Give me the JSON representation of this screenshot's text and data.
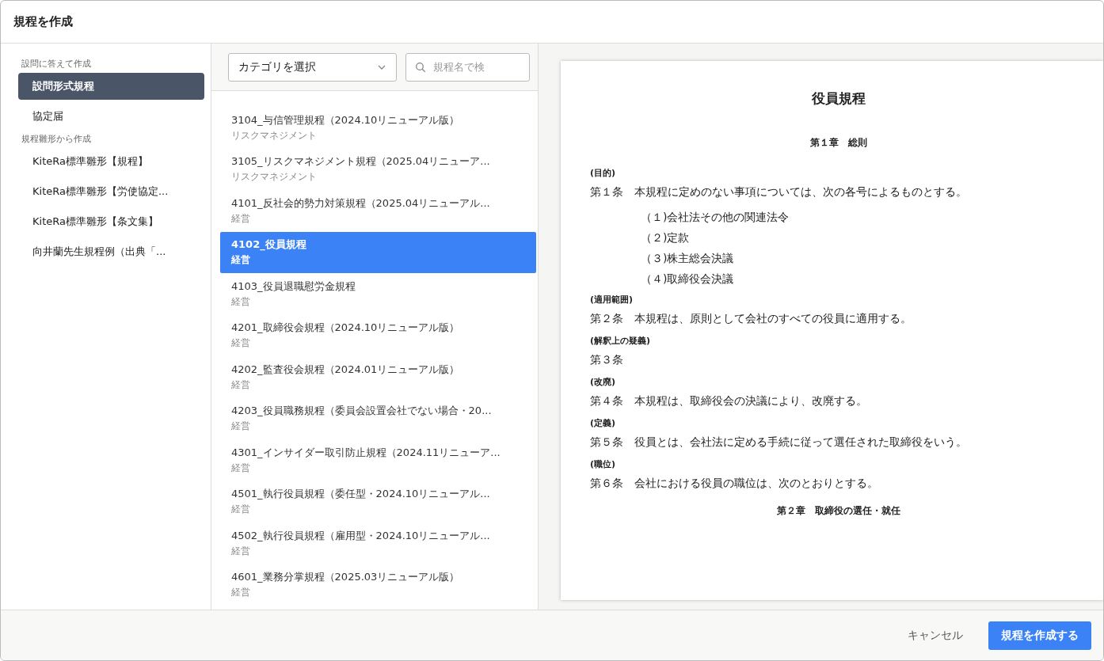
{
  "window": {
    "title": "規程を作成"
  },
  "sidebar": {
    "groups": [
      {
        "label": "設問に答えて作成",
        "items": [
          {
            "label": "設問形式規程",
            "selected": true
          },
          {
            "label": "協定届",
            "selected": false
          }
        ]
      },
      {
        "label": "規程雛形から作成",
        "items": [
          {
            "label": "KiteRa標準雛形【規程】",
            "selected": false
          },
          {
            "label": "KiteRa標準雛形【労使協定...",
            "selected": false
          },
          {
            "label": "KiteRa標準雛形【条文集】",
            "selected": false
          },
          {
            "label": "向井蘭先生規程例（出典「...",
            "selected": false
          }
        ]
      }
    ]
  },
  "filters": {
    "category": {
      "value": "カテゴリを選択"
    },
    "search": {
      "placeholder": "規程名で検"
    }
  },
  "templates": [
    {
      "name": "3104_与信管理規程（2024.10リニューアル版）",
      "category": "リスクマネジメント",
      "selected": false
    },
    {
      "name": "3105_リスクマネジメント規程（2025.04リニューア...",
      "category": "リスクマネジメント",
      "selected": false
    },
    {
      "name": "4101_反社会的勢力対策規程（2025.04リニューアル...",
      "category": "経営",
      "selected": false
    },
    {
      "name": "4102_役員規程",
      "category": "経営",
      "selected": true
    },
    {
      "name": "4103_役員退職慰労金規程",
      "category": "経営",
      "selected": false
    },
    {
      "name": "4201_取締役会規程（2024.10リニューアル版）",
      "category": "経営",
      "selected": false
    },
    {
      "name": "4202_監査役会規程（2024.01リニューアル版）",
      "category": "経営",
      "selected": false
    },
    {
      "name": "4203_役員職務規程（委員会設置会社でない場合・20...",
      "category": "経営",
      "selected": false
    },
    {
      "name": "4301_インサイダー取引防止規程（2024.11リニューア...",
      "category": "経営",
      "selected": false
    },
    {
      "name": "4501_執行役員規程（委任型・2024.10リニューアル...",
      "category": "経営",
      "selected": false
    },
    {
      "name": "4502_執行役員規程（雇用型・2024.10リニューアル...",
      "category": "経営",
      "selected": false
    },
    {
      "name": "4601_業務分掌規程（2025.03リニューアル版）",
      "category": "経営",
      "selected": false
    }
  ],
  "preview": {
    "title": "役員規程",
    "blocks": [
      {
        "kind": "chapter",
        "text": "第１章　総則"
      },
      {
        "kind": "heading",
        "text": "(目的)"
      },
      {
        "kind": "article",
        "text": "第１条　本規程に定めのない事項については、次の各号によるものとする。"
      },
      {
        "kind": "clause",
        "text": "（１)会社法その他の関連法令"
      },
      {
        "kind": "clause",
        "text": "（２)定款"
      },
      {
        "kind": "clause",
        "text": "（３)株主総会決議"
      },
      {
        "kind": "clause",
        "text": "（４)取締役会決議"
      },
      {
        "kind": "heading",
        "text": "(適用範囲)"
      },
      {
        "kind": "article",
        "text": "第２条　本規程は、原則として会社のすべての役員に適用する。"
      },
      {
        "kind": "heading",
        "text": "(解釈上の疑義)"
      },
      {
        "kind": "article",
        "text": "第３条"
      },
      {
        "kind": "heading",
        "text": "(改廃)"
      },
      {
        "kind": "article",
        "text": "第４条　本規程は、取締役会の決議により、改廃する。"
      },
      {
        "kind": "heading",
        "text": "(定義)"
      },
      {
        "kind": "article",
        "text": "第５条　役員とは、会社法に定める手続に従って選任された取締役をいう。"
      },
      {
        "kind": "heading",
        "text": "(職位)"
      },
      {
        "kind": "article",
        "text": "第６条　会社における役員の職位は、次のとおりとする。"
      },
      {
        "kind": "chapter",
        "text": "第２章　取締役の選任・就任"
      }
    ]
  },
  "footer": {
    "buttons": [
      {
        "label": "キャンセル",
        "kind": "secondary"
      },
      {
        "label": "規程を作成する",
        "kind": "primary"
      }
    ]
  }
}
